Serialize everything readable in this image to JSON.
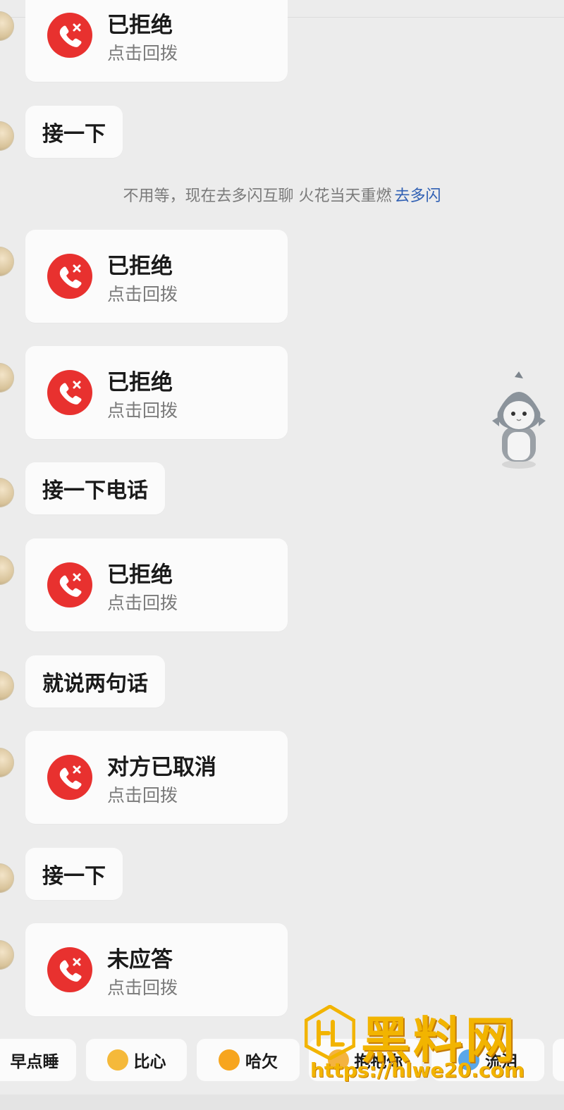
{
  "chat": {
    "messages": [
      {
        "kind": "call",
        "title": "已拒绝",
        "subtitle": "点击回拨"
      },
      {
        "kind": "text",
        "text": "接一下"
      },
      {
        "kind": "notice",
        "text": "不用等，现在去多闪互聊 火花当天重燃",
        "link": "去多闪"
      },
      {
        "kind": "call",
        "title": "已拒绝",
        "subtitle": "点击回拨"
      },
      {
        "kind": "call",
        "title": "已拒绝",
        "subtitle": "点击回拨"
      },
      {
        "kind": "text",
        "text": "接一下电话"
      },
      {
        "kind": "call",
        "title": "已拒绝",
        "subtitle": "点击回拨"
      },
      {
        "kind": "text",
        "text": "就说两句话"
      },
      {
        "kind": "call",
        "title": "对方已取消",
        "subtitle": "点击回拨"
      },
      {
        "kind": "text",
        "text": "接一下"
      },
      {
        "kind": "call",
        "title": "未应答",
        "subtitle": "点击回拨"
      }
    ]
  },
  "quick_replies": [
    {
      "label": "早点睡",
      "icon": ""
    },
    {
      "label": "比心",
      "icon": "heart-hands-emoji-icon"
    },
    {
      "label": "哈欠",
      "icon": "yawn-emoji-icon"
    },
    {
      "label": "抱抱你",
      "icon": "hug-emoji-icon"
    },
    {
      "label": "流泪",
      "icon": "crying-emoji-icon"
    }
  ],
  "watermark": {
    "name": "黑料网",
    "url": "https://hlwe20.com"
  },
  "colors": {
    "background": "#ececec",
    "bubble": "#fbfbfb",
    "call_red": "#e8312f",
    "link_blue": "#2f5fb3",
    "watermark_gold": "#f2b400"
  }
}
